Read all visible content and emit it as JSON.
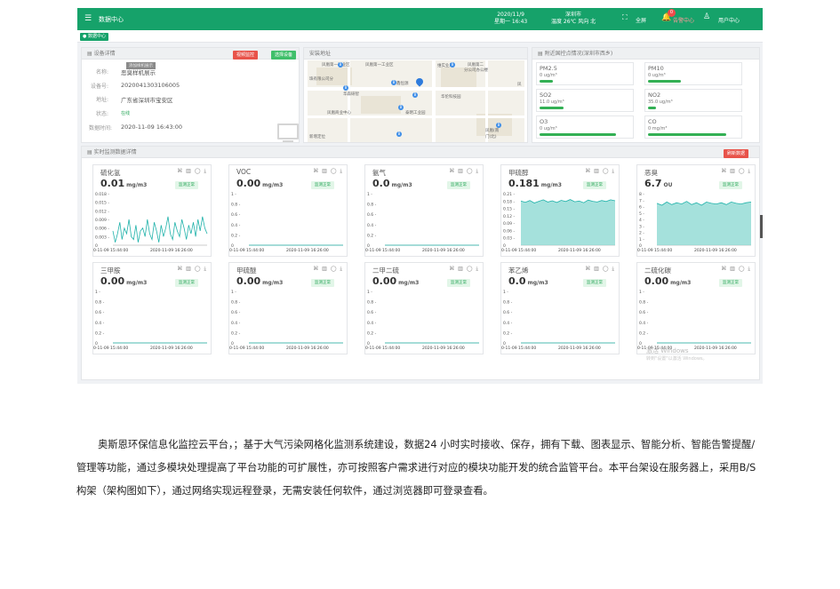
{
  "topbar": {
    "menu_icon": "menu-icon",
    "title": "数据中心",
    "date": "2020/11/9",
    "weekday_time": "星期一 16:43",
    "location": "深圳市",
    "weather": "温度 26℃ 风向 北",
    "fullscreen_label": "全屏",
    "alarm_label": "告警中心",
    "alarm_count": "0",
    "user_label": "用户中心"
  },
  "tab": "数据中心",
  "device": {
    "header": "设备详情",
    "tooltip": "添加样机展示",
    "btn_video": "视频监控",
    "btn_select": "选择设备",
    "name_label": "名称:",
    "name": "恶臭样机展示",
    "id_label": "设备号:",
    "id": "2020041303106005",
    "addr_label": "地址:",
    "addr": "广东省深圳市宝安区",
    "status_label": "状态:",
    "status": "在线",
    "time_label": "数据时间:",
    "time": "2020-11-09 16:43:00"
  },
  "map": {
    "header": "安装地址",
    "labels": [
      "凤凰第一工业区",
      "凤凰第一工业区",
      "凤凰第二",
      "分公司办公楼",
      "珠有限公司分",
      "维实业厂",
      "鑫恒源",
      "华森研智",
      "华伦科技园",
      "凤凰商业中心",
      "泰明工业园",
      "凤凰(南",
      "门(北)",
      "新增定位",
      "凤"
    ]
  },
  "air": {
    "header": "附近国控点情况(深圳市西乡)",
    "items": [
      {
        "name": "PM2.5",
        "value": "0 ug/m³",
        "fill": 0.15
      },
      {
        "name": "PM10",
        "value": "0 ug/m³",
        "fill": 0.37
      },
      {
        "name": "SO2",
        "value": "11.0 ug/m³",
        "fill": 0.27
      },
      {
        "name": "NO2",
        "value": "35.0 ug/m³",
        "fill": 0.09
      },
      {
        "name": "O3",
        "value": "0 ug/m³",
        "fill": 0.86
      },
      {
        "name": "CO",
        "value": "0 mg/m³",
        "fill": 0.88
      }
    ]
  },
  "realtime": {
    "header": "实时监测数据详情",
    "refresh": "刷新数据",
    "status": "监测正常",
    "x_start": "0-11-09 15:44:00",
    "x_end": "2020-11-09 16:26:00"
  },
  "chart_data": [
    {
      "type": "line",
      "title": "硫化氢",
      "value": "0.01",
      "unit": "mg/m3",
      "ylim": [
        0,
        0.018
      ],
      "yticks": [
        "0.018",
        "0.015",
        "0.012",
        "0.009",
        "0.006",
        "0.003",
        "0"
      ],
      "x": [
        "0-11-09 15:44:00",
        "2020-11-09 16:26:00"
      ],
      "values": [
        0.005,
        0.001,
        0.004,
        0.008,
        0.002,
        0.006,
        0.004,
        0.009,
        0.003,
        0.002,
        0.007,
        0.001,
        0.005,
        0.006,
        0.003,
        0.009,
        0.004,
        0.002,
        0.008,
        0.005,
        0.001,
        0.007,
        0.003,
        0.006,
        0.01,
        0.004,
        0.002,
        0.008,
        0.005,
        0.003,
        0.009,
        0.006,
        0.002,
        0.007,
        0.004,
        0.008,
        0.003,
        0.009,
        0.005,
        0.01,
        0.006,
        0.004
      ]
    },
    {
      "type": "line",
      "title": "VOC",
      "value": "0.00",
      "unit": "mg/m3",
      "ylim": [
        0,
        1
      ],
      "yticks": [
        "1",
        "0.8",
        "0.6",
        "0.4",
        "0.2",
        "0"
      ],
      "x": [
        "0-11-09 15:44:00",
        "2020-11-09 16:26:00"
      ],
      "values": [
        0,
        0,
        0,
        0,
        0,
        0,
        0,
        0,
        0,
        0
      ]
    },
    {
      "type": "line",
      "title": "氨气",
      "value": "0.0",
      "unit": "mg/m3",
      "ylim": [
        0,
        1
      ],
      "yticks": [
        "1",
        "0.8",
        "0.6",
        "0.4",
        "0.2",
        "0"
      ],
      "x": [
        "0-11-09 15:44:00",
        "2020-11-09 16:26:00"
      ],
      "values": [
        0,
        0,
        0,
        0,
        0,
        0,
        0,
        0,
        0,
        0
      ]
    },
    {
      "type": "area",
      "title": "甲硫醇",
      "value": "0.181",
      "unit": "mg/m3",
      "ylim": [
        0,
        0.21
      ],
      "yticks": [
        "0.21",
        "0.18",
        "0.15",
        "0.12",
        "0.09",
        "0.06",
        "0.03",
        "0"
      ],
      "x": [
        "0-11-09 15:44:00",
        "2020-11-09 16:26:00"
      ],
      "values": [
        0.18,
        0.175,
        0.182,
        0.172,
        0.179,
        0.185,
        0.176,
        0.181,
        0.174,
        0.183,
        0.178,
        0.186,
        0.177,
        0.18,
        0.173,
        0.184,
        0.179,
        0.176,
        0.182,
        0.178,
        0.185,
        0.181
      ]
    },
    {
      "type": "area",
      "title": "恶臭",
      "value": "6.7",
      "unit": "OU",
      "ylim": [
        0,
        8
      ],
      "yticks": [
        "8",
        "7",
        "6",
        "5",
        "4",
        "3",
        "2",
        "1",
        "0"
      ],
      "x": [
        "0-11-09 15:44:00",
        "2020-11-09 16:26:00"
      ],
      "values": [
        6.5,
        6.2,
        6.7,
        6.3,
        6.6,
        6.4,
        6.8,
        6.3,
        6.6,
        6.2,
        6.7,
        6.5,
        6.4,
        6.6,
        6.3,
        6.7,
        6.5,
        6.4,
        6.6,
        6.7
      ]
    },
    {
      "type": "line",
      "title": "三甲胺",
      "value": "0.00",
      "unit": "mg/m3",
      "ylim": [
        0,
        1
      ],
      "yticks": [
        "1",
        "0.8",
        "0.6",
        "0.4",
        "0.2",
        "0"
      ],
      "x": [
        "0-11-09 15:44:00",
        "2020-11-09 16:26:00"
      ],
      "values": [
        0,
        0,
        0,
        0,
        0,
        0,
        0,
        0,
        0,
        0
      ]
    },
    {
      "type": "line",
      "title": "甲硫醚",
      "value": "0.00",
      "unit": "mg/m3",
      "ylim": [
        0,
        1
      ],
      "yticks": [
        "1",
        "0.8",
        "0.6",
        "0.4",
        "0.2",
        "0"
      ],
      "x": [
        "0-11-09 15:44:00",
        "2020-11-09 16:26:00"
      ],
      "values": [
        0,
        0,
        0,
        0,
        0,
        0,
        0,
        0,
        0,
        0
      ]
    },
    {
      "type": "line",
      "title": "二甲二硫",
      "value": "0.00",
      "unit": "mg/m3",
      "ylim": [
        0,
        1
      ],
      "yticks": [
        "1",
        "0.8",
        "0.6",
        "0.4",
        "0.2",
        "0"
      ],
      "x": [
        "0-11-09 15:44:00",
        "2020-11-09 16:26:00"
      ],
      "values": [
        0,
        0,
        0,
        0,
        0,
        0,
        0,
        0,
        0,
        0
      ]
    },
    {
      "type": "line",
      "title": "苯乙烯",
      "value": "0.0",
      "unit": "mg/m3",
      "ylim": [
        0,
        1
      ],
      "yticks": [
        "1",
        "0.8",
        "0.6",
        "0.4",
        "0.2",
        "0"
      ],
      "x": [
        "0-11-09 15:44:00",
        "2020-11-09 16:26:00"
      ],
      "values": [
        0,
        0,
        0,
        0,
        0,
        0,
        0,
        0,
        0,
        0
      ]
    },
    {
      "type": "line",
      "title": "二硫化碳",
      "value": "0.00",
      "unit": "mg/m3",
      "ylim": [
        0,
        1
      ],
      "yticks": [
        "1",
        "0.8",
        "0.6",
        "0.4",
        "0.2",
        "0"
      ],
      "x": [
        "0-11-09 15:44:00",
        "2020-11-09 16:26:00"
      ],
      "values": [
        0,
        0,
        0,
        0,
        0,
        0,
        0,
        0,
        0,
        0
      ]
    }
  ],
  "watermark": {
    "line1": "激活 Windows",
    "line2": "转到\"设置\"以激活 Windows。"
  },
  "paragraph": "奥斯恩环保信息化监控云平台，；基于大气污染网格化监测系统建设，数据24 小时实时接收、保存，拥有下载、图表显示、智能分析、智能告警提醒/管理等功能，通过多模块处理提高了平台功能的可扩展性，亦可按照客户需求进行对应的模块功能开发的统合监管平台。本平台架设在服务器上，采用B/S 构架（架构图如下），通过网络实现远程登录，无需安装任何软件，通过浏览器即可登录查看。",
  "colors": {
    "brand": "#16a26a",
    "accent": "#20b2aa",
    "alarm": "#f04a4a"
  }
}
